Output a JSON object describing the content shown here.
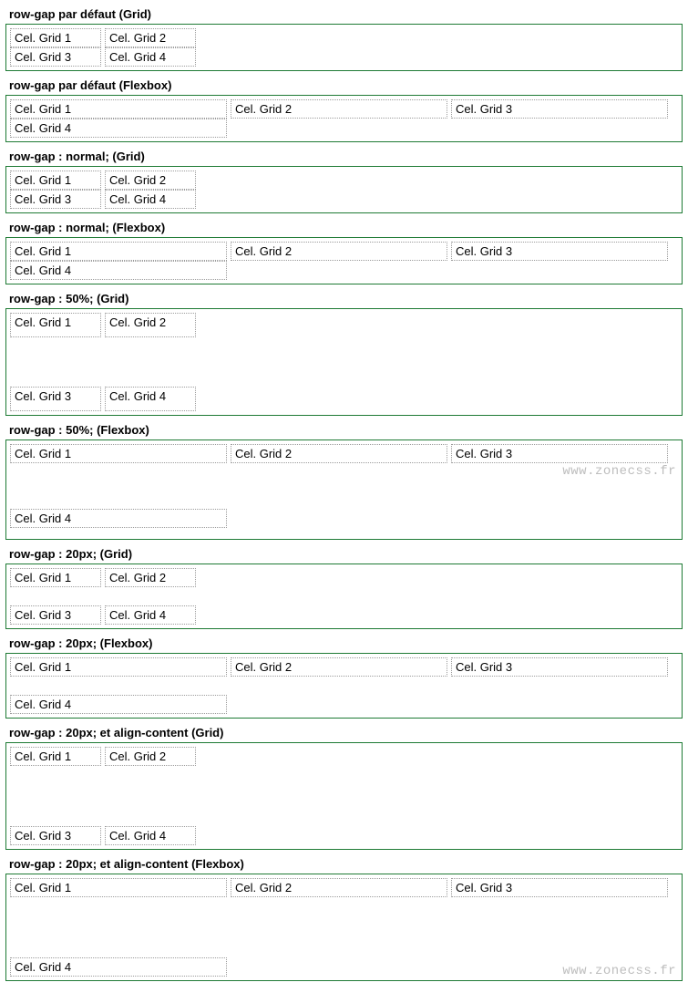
{
  "watermark": "www.zonecss.fr",
  "cells": {
    "c1": "Cel. Grid 1",
    "c2": "Cel. Grid 2",
    "c3": "Cel. Grid 3",
    "c4": "Cel. Grid 4"
  },
  "sections": {
    "s1": {
      "title": "row-gap par défaut (Grid)"
    },
    "s2": {
      "title": "row-gap par défaut (Flexbox)"
    },
    "s3": {
      "title": "row-gap : normal; (Grid)"
    },
    "s4": {
      "title": "row-gap : normal; (Flexbox)"
    },
    "s5": {
      "title": "row-gap : 50%; (Grid)"
    },
    "s6": {
      "title": "row-gap : 50%; (Flexbox)"
    },
    "s7": {
      "title": "row-gap : 20px; (Grid)"
    },
    "s8": {
      "title": "row-gap : 20px; (Flexbox)"
    },
    "s9": {
      "title": "row-gap : 20px; et align-content (Grid)"
    },
    "s10": {
      "title": "row-gap : 20px; et align-content (Flexbox)"
    }
  }
}
